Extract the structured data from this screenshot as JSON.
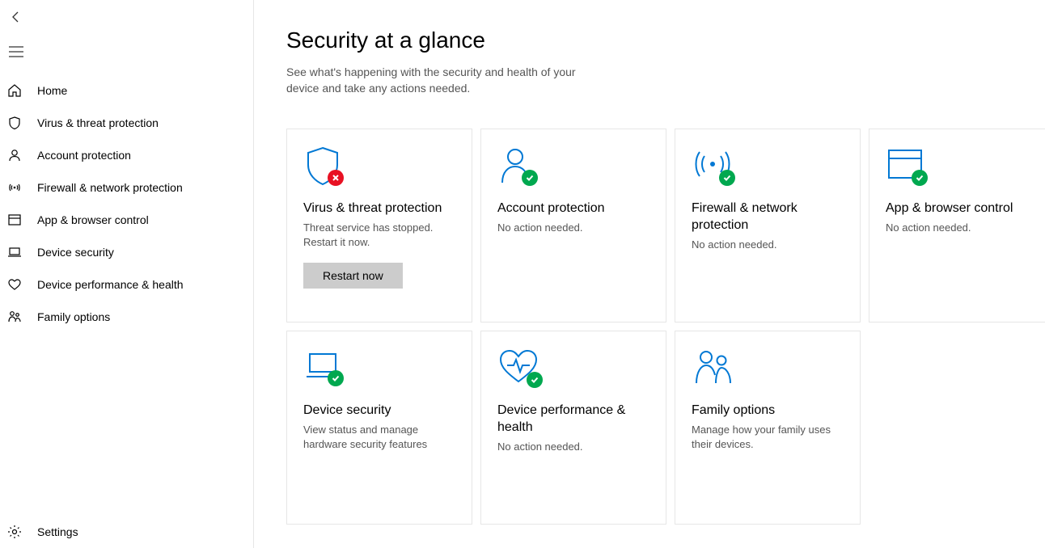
{
  "sidebar": {
    "items": [
      {
        "label": "Home"
      },
      {
        "label": "Virus & threat protection"
      },
      {
        "label": "Account protection"
      },
      {
        "label": "Firewall & network protection"
      },
      {
        "label": "App & browser control"
      },
      {
        "label": "Device security"
      },
      {
        "label": "Device performance & health"
      },
      {
        "label": "Family options"
      }
    ],
    "settings_label": "Settings"
  },
  "main": {
    "title": "Security at a glance",
    "subtitle": "See what's happening with the security and health of your device and take any actions needed."
  },
  "tiles": [
    {
      "title": "Virus & threat protection",
      "desc": "Threat service has stopped. Restart it now.",
      "status": "error",
      "action_label": "Restart now"
    },
    {
      "title": "Account protection",
      "desc": "No action needed.",
      "status": "ok"
    },
    {
      "title": "Firewall & network protection",
      "desc": "No action needed.",
      "status": "ok"
    },
    {
      "title": "App & browser control",
      "desc": "No action needed.",
      "status": "ok"
    },
    {
      "title": "Device security",
      "desc": "View status and manage hardware security features",
      "status": "ok"
    },
    {
      "title": "Device performance & health",
      "desc": "No action needed.",
      "status": "ok"
    },
    {
      "title": "Family options",
      "desc": "Manage how your family uses their devices.",
      "status": "none"
    }
  ],
  "colors": {
    "accent": "#0078d4",
    "ok": "#00a84f",
    "error": "#e81123"
  }
}
